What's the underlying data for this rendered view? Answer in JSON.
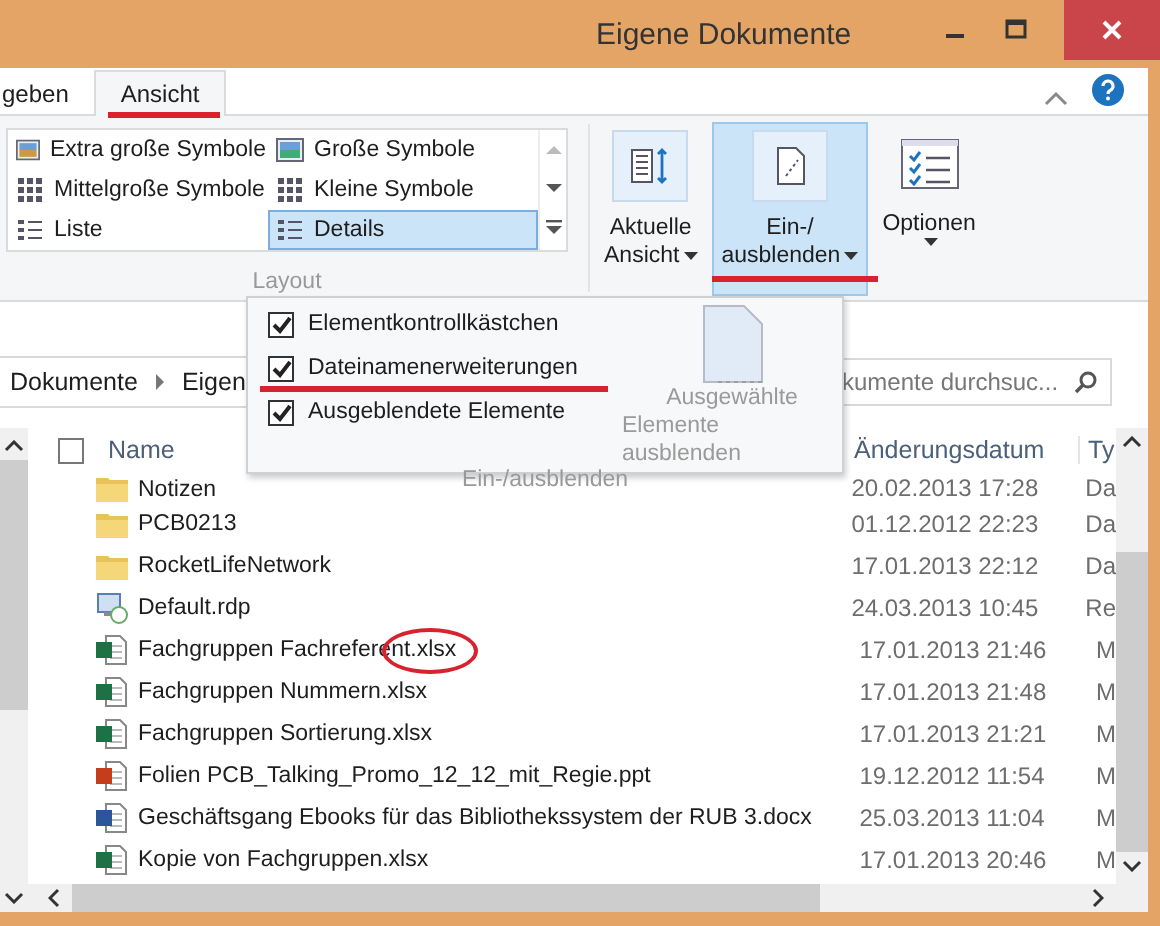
{
  "window": {
    "title": "Eigene Dokumente"
  },
  "tabs": [
    {
      "label": "geben",
      "selected": false,
      "underlined": false
    },
    {
      "label": "Ansicht",
      "selected": true,
      "underlined": true
    }
  ],
  "layout_group": {
    "label": "Layout",
    "options": [
      {
        "label": "Extra große Symbole",
        "kind": "xl",
        "selected": false
      },
      {
        "label": "Große Symbole",
        "kind": "large",
        "selected": false
      },
      {
        "label": "Mittelgroße Symbole",
        "kind": "medium",
        "selected": false
      },
      {
        "label": "Kleine Symbole",
        "kind": "small",
        "selected": false
      },
      {
        "label": "Liste",
        "kind": "list",
        "selected": false
      },
      {
        "label": "Details",
        "kind": "details",
        "selected": true
      }
    ]
  },
  "ribbon_buttons": [
    {
      "kind": "current-view",
      "lines": [
        "Aktuelle",
        "Ansicht"
      ],
      "active": false,
      "underlined": false
    },
    {
      "kind": "show-hide",
      "lines": [
        "Ein-/",
        "ausblenden"
      ],
      "active": true,
      "underlined": true
    },
    {
      "kind": "options",
      "lines": [
        "Optionen"
      ],
      "active": false,
      "underlined": false
    }
  ],
  "dropdown": {
    "options": [
      {
        "label": "Elementkontrollkästchen",
        "checked": true,
        "underlined": false
      },
      {
        "label": "Dateinamenerweiterungen",
        "checked": true,
        "underlined": true
      },
      {
        "label": "Ausgeblendete Elemente",
        "checked": true,
        "underlined": false
      }
    ],
    "action": {
      "lines": [
        "Ausgewählte",
        "Elemente ausblenden"
      ],
      "disabled": true
    },
    "group_label": "Ein-/ausblenden"
  },
  "address": {
    "breadcrumbs": [
      "Dokumente",
      "Eigen"
    ]
  },
  "select_all": {
    "checked": false
  },
  "search": {
    "placeholder": "kumente durchsuc..."
  },
  "columns": [
    "Name",
    "Änderungsdatum",
    "Ty"
  ],
  "files": [
    {
      "name": "Notizen",
      "kind": "folder",
      "date": "20.02.2013 17:28",
      "type": "Da",
      "circled": false
    },
    {
      "name": "PCB0213",
      "kind": "folder",
      "date": "01.12.2012 22:23",
      "type": "Da",
      "circled": false
    },
    {
      "name": "RocketLifeNetwork",
      "kind": "folder",
      "date": "17.01.2013 22:12",
      "type": "Da",
      "circled": false
    },
    {
      "name": "Default.rdp",
      "kind": "rdp",
      "date": "24.03.2013 10:45",
      "type": "Re",
      "circled": false
    },
    {
      "name": "Fachgruppen Fachreferent.xlsx",
      "kind": "excel",
      "date": "17.01.2013 21:46",
      "type": "M",
      "circled": true
    },
    {
      "name": "Fachgruppen Nummern.xlsx",
      "kind": "excel",
      "date": "17.01.2013 21:48",
      "type": "M",
      "circled": false
    },
    {
      "name": "Fachgruppen Sortierung.xlsx",
      "kind": "excel",
      "date": "17.01.2013 21:21",
      "type": "M",
      "circled": false
    },
    {
      "name": "Folien PCB_Talking_Promo_12_12_mit_Regie.ppt",
      "kind": "powerpoint",
      "date": "19.12.2012 11:54",
      "type": "M",
      "circled": false
    },
    {
      "name": "Geschäftsgang Ebooks für das Bibliothekssystem der RUB 3.docx",
      "kind": "word",
      "date": "25.03.2013 11:04",
      "type": "M",
      "circled": false
    },
    {
      "name": "Kopie von Fachgruppen.xlsx",
      "kind": "excel",
      "date": "17.01.2013 20:46",
      "type": "M",
      "circled": false
    }
  ]
}
